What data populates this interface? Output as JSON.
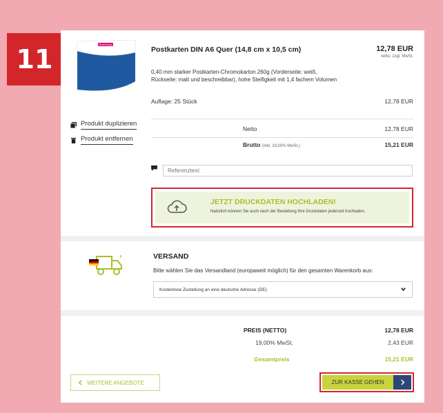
{
  "step": {
    "number": "11"
  },
  "product": {
    "thumb_logo_text": "Musterlogo",
    "title": "Postkarten DIN A6 Quer (14,8 cm x 10,5 cm)",
    "price": "12,78 EUR",
    "price_note": "netto, zzgl. MwSt.",
    "description": "0,40 mm starker Postkarten-Chromokarton 260g (Vorderseite: weiß, Rückseite: matt und beschreibbar), hohe Steifigkeit mit 1,4 fachem Volumen",
    "quantity_label": "Auflage: 25 Stück",
    "quantity_price": "12,78 EUR",
    "duplicate_label": "Produkt duplizieren",
    "remove_label": "Produkt entfernen",
    "netto_label": "Netto",
    "netto_value": "12,78 EUR",
    "brutto_label": "Brutto",
    "brutto_note": "(inkl. 19,00% MwSt.)",
    "brutto_value": "15,21 EUR",
    "reference_placeholder": "Referenztext:"
  },
  "upload": {
    "title": "JETZT DRUCKDATEN HOCHLADEN!",
    "subtitle": "Natürlich können Sie auch nach der Bestellung Ihre Druckdaten jederzeit hochladen."
  },
  "versand": {
    "title": "VERSAND",
    "description": "Bitte wählen Sie das Versandland (europaweit möglich) für den gesamten Warenkorb aus:",
    "selected": "Kostenlose Zustellung an eine deutsche Adresse (DE)"
  },
  "summary": {
    "price_label": "PREIS (NETTO)",
    "price_value": "12,78 EUR",
    "tax_label": "19,00% MwSt.",
    "tax_value": "2,43 EUR",
    "total_label": "Gesamtpreis",
    "total_value": "15,21 EUR"
  },
  "buttons": {
    "back_label": "WEITERE ANGEBOTE",
    "checkout_label": "ZUR KASSE GEHEN"
  },
  "colors": {
    "accent_green": "#a9bf2a",
    "highlight_red": "#d3262b",
    "navy": "#2d4579"
  }
}
